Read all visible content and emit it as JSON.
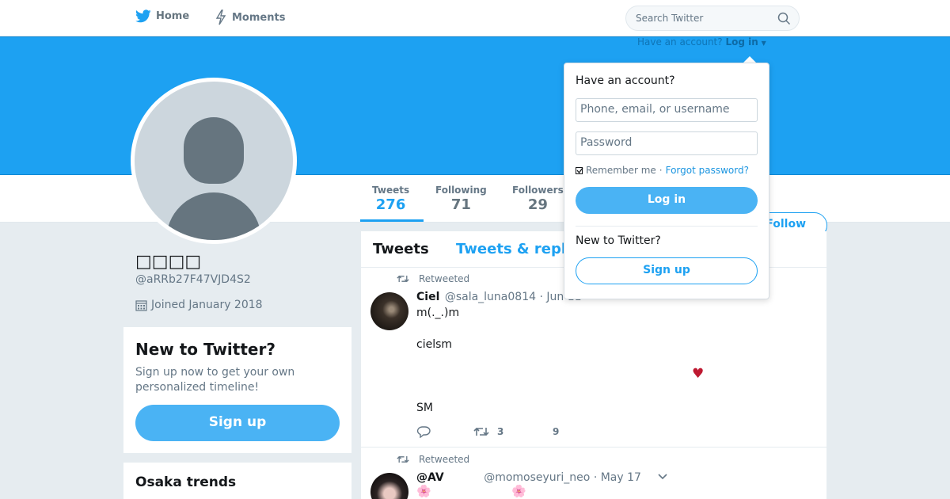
{
  "topbar": {
    "home_label": "Home",
    "moments_label": "Moments",
    "search_placeholder": "Search Twitter"
  },
  "login_prompt": {
    "text": "Have an account?",
    "link": "Log in"
  },
  "profile": {
    "display_name": "□□□□",
    "handle": "@aRRb27F47VJD4S2",
    "joined": "Joined January 2018"
  },
  "stats": [
    {
      "label": "Tweets",
      "value": "276"
    },
    {
      "label": "Following",
      "value": "71"
    },
    {
      "label": "Followers",
      "value": "29"
    }
  ],
  "follow_label": "Follow",
  "new_card": {
    "title": "New to Twitter?",
    "body": "Sign up now to get your own personalized timeline!",
    "signup": "Sign up"
  },
  "trends": {
    "title": "Osaka trends"
  },
  "timeline": {
    "tabs": [
      "Tweets",
      "Tweets & repl"
    ],
    "tweets": [
      {
        "retweeted": "Retweeted",
        "name": "Ciel",
        "handle": "@sala_luna0814",
        "date": "· Jun 11",
        "lines": [
          "m(._.)m",
          "cielsm",
          "SM"
        ],
        "heart_emoji": "♥",
        "retweets": "3",
        "likes": "9"
      },
      {
        "retweeted": "Retweeted",
        "name": "@AV",
        "handle": "@momoseyuri_neo",
        "date": "· May 17",
        "flowers": [
          "🌸",
          "🌸"
        ]
      }
    ]
  },
  "dropdown": {
    "title": "Have an account?",
    "username_placeholder": "Phone, email, or username",
    "password_placeholder": "Password",
    "remember": "Remember me",
    "dot": "·",
    "forgot": "Forgot password?",
    "login": "Log in",
    "new_title": "New to Twitter?",
    "signup": "Sign up"
  },
  "colors": {
    "brand": "#1da1f2",
    "button": "#4ab3f4"
  }
}
